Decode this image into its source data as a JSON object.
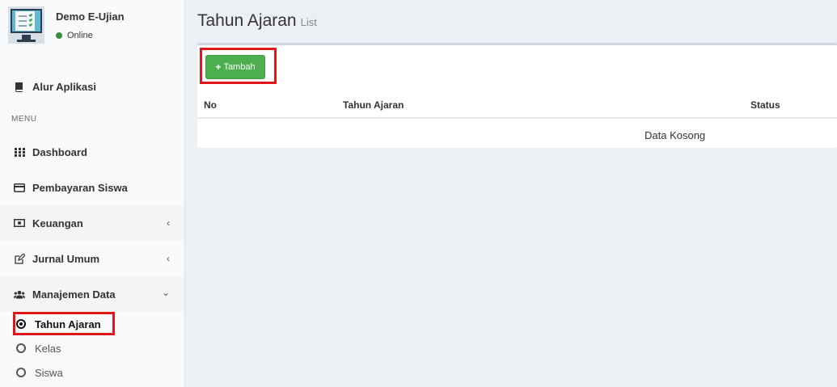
{
  "user": {
    "name": "Demo E-Ujian",
    "status": "Online"
  },
  "sidebar": {
    "top_item": "Alur Aplikasi",
    "menu_header": "MENU",
    "items": [
      {
        "label": "Dashboard",
        "icon": "grid-icon"
      },
      {
        "label": "Pembayaran Siswa",
        "icon": "credit-card-icon"
      },
      {
        "label": "Keuangan",
        "icon": "money-icon"
      },
      {
        "label": "Jurnal Umum",
        "icon": "edit-icon"
      },
      {
        "label": "Manajemen Data",
        "icon": "users-icon"
      }
    ],
    "sub_items": [
      "Tahun Ajaran",
      "Kelas",
      "Siswa"
    ]
  },
  "page": {
    "title": "Tahun Ajaran",
    "subtitle": "List"
  },
  "toolbar": {
    "add_label": "Tambah"
  },
  "table": {
    "headers": [
      "No",
      "Tahun Ajaran",
      "Status"
    ],
    "empty_text": "Data Kosong"
  },
  "colors": {
    "add_button": "#4cae4c",
    "highlight": "#e0161b",
    "online": "#3c8d3f"
  }
}
